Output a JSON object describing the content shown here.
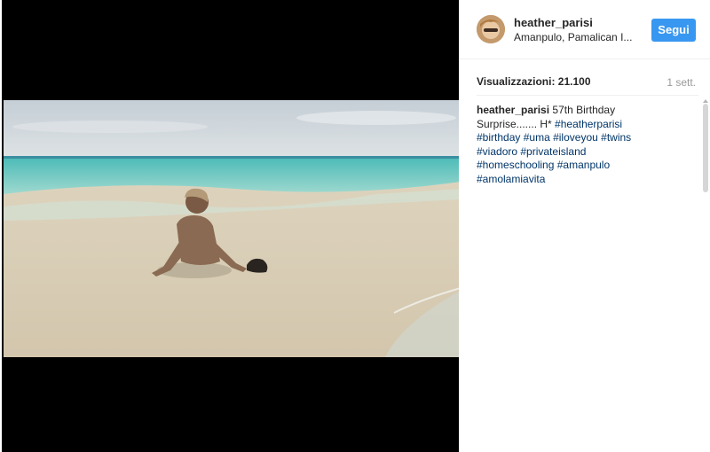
{
  "post": {
    "author": "heather_parisi",
    "location": "Amanpulo, Pamalican I...",
    "follow_label": "Segui",
    "views_label": "Visualizzazioni: 21.100",
    "age": "1 sett.",
    "caption_text": "57th Birthday Surprise....... H*",
    "hashtags": [
      "#heatherparisi",
      "#birthday",
      "#uma",
      "#iloveyou",
      "#twins",
      "#viadoro",
      "#privateisland",
      "#homeschooling",
      "#amanpulo",
      "#amolamiavita"
    ]
  },
  "media": {
    "icon": "beach-video-frame",
    "colors": {
      "sky": "#cfd7dd",
      "sea": "#7ccfc4",
      "sand": "#d8ccb4"
    }
  },
  "colors": {
    "accent": "#3897f0",
    "hashtag": "#003569",
    "text": "#262626"
  }
}
